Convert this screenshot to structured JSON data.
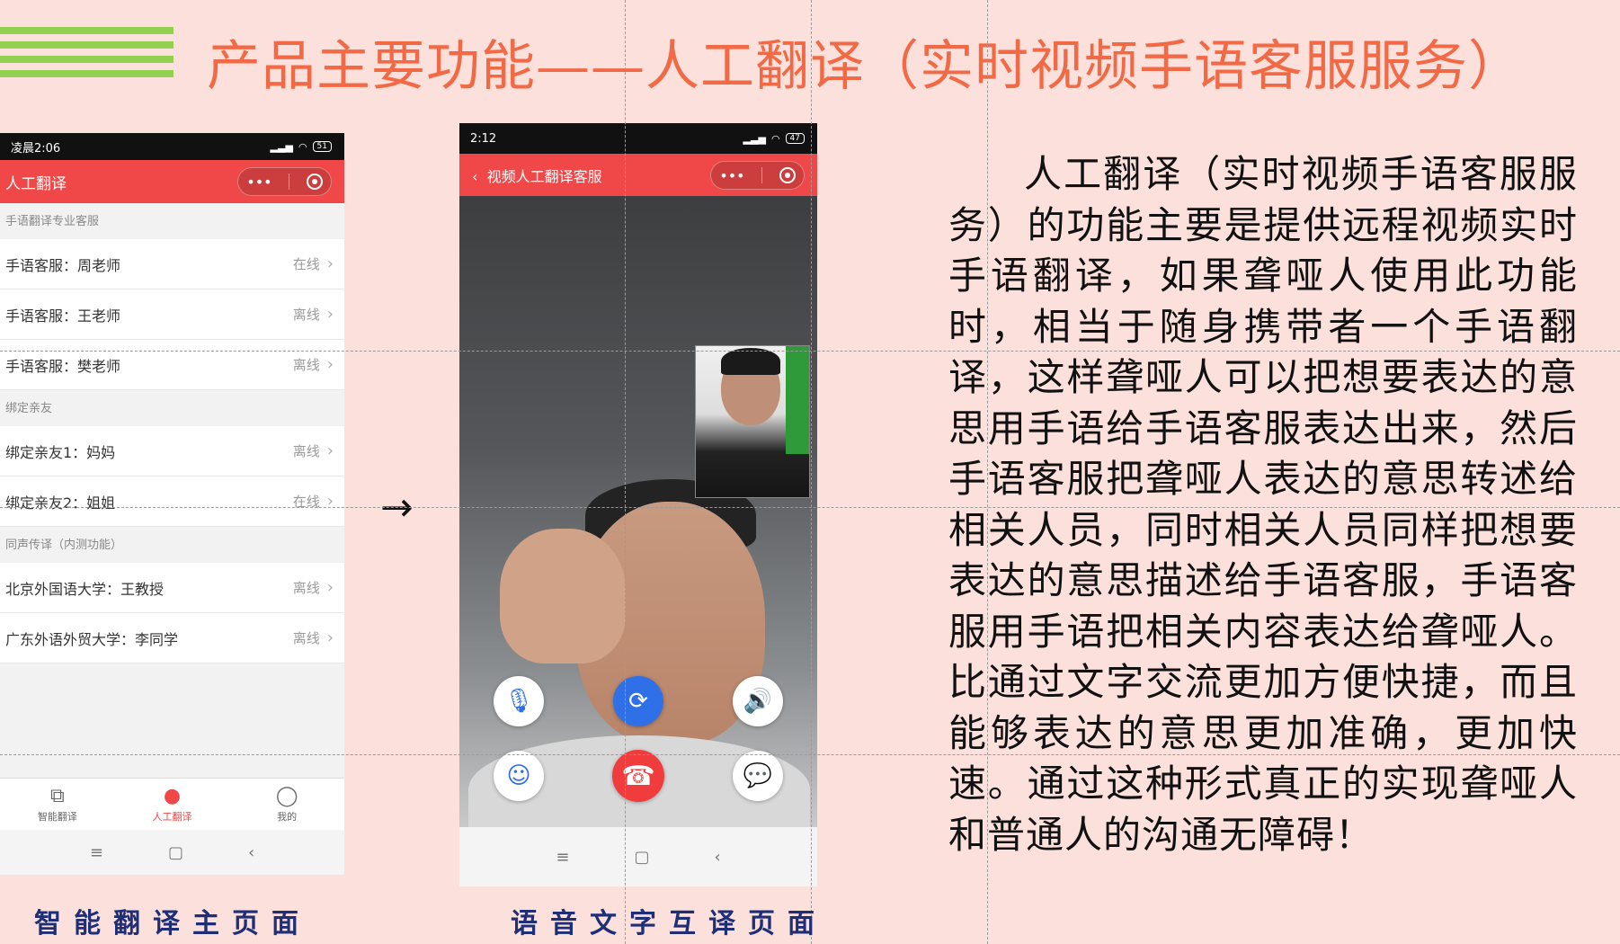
{
  "slide_title": "产品主要功能——人工翻译（实时视频手语客服服务）",
  "phone1": {
    "time": "凌晨2:06",
    "battery": "51",
    "title": "人工翻译",
    "sections": [
      {
        "label": "手语翻译专业客服",
        "rows": [
          {
            "name": "手语客服：周老师",
            "status": "在线"
          },
          {
            "name": "手语客服：王老师",
            "status": "离线"
          },
          {
            "name": "手语客服：樊老师",
            "status": "离线"
          }
        ]
      },
      {
        "label": "绑定亲友",
        "rows": [
          {
            "name": "绑定亲友1：妈妈",
            "status": "离线"
          },
          {
            "name": "绑定亲友2：姐姐",
            "status": "在线"
          }
        ]
      },
      {
        "label": "同声传译（内测功能）",
        "rows": [
          {
            "name": "北京外国语大学：王教授",
            "status": "离线"
          },
          {
            "name": "广东外语外贸大学：李同学",
            "status": "离线"
          }
        ]
      }
    ],
    "tabs": [
      {
        "label": "智能翻译",
        "icon": "translate-icon"
      },
      {
        "label": "人工翻译",
        "icon": "person-icon"
      },
      {
        "label": "我的",
        "icon": "profile-icon"
      }
    ]
  },
  "phone2": {
    "time": "2:12",
    "battery": "47",
    "title": "视频人工翻译客服"
  },
  "captions": {
    "left": "智能翻译主页面",
    "middle": "语音文字互译页面"
  },
  "description": "人工翻译（实时视频手语客服服务）的功能主要是提供远程视频实时手语翻译，如果聋哑人使用此功能时，相当于随身携带者一个手语翻译，这样聋哑人可以把想要表达的意思用手语给手语客服表达出来，然后手语客服把聋哑人表达的意思转述给相关人员，同时相关人员同样把想要表达的意思描述给手语客服，手语客服用手语把相关内容表达给聋哑人。比通过文字交流更加方便快捷，而且能够表达的意思更加准确，更加快速。通过这种形式真正的实现聋哑人和普通人的沟通无障碍！",
  "colors": {
    "background": "#fce0db",
    "title": "#f26a45",
    "accent_red": "#f04848",
    "stripes": "#92d050",
    "caption": "#1e2f78"
  }
}
